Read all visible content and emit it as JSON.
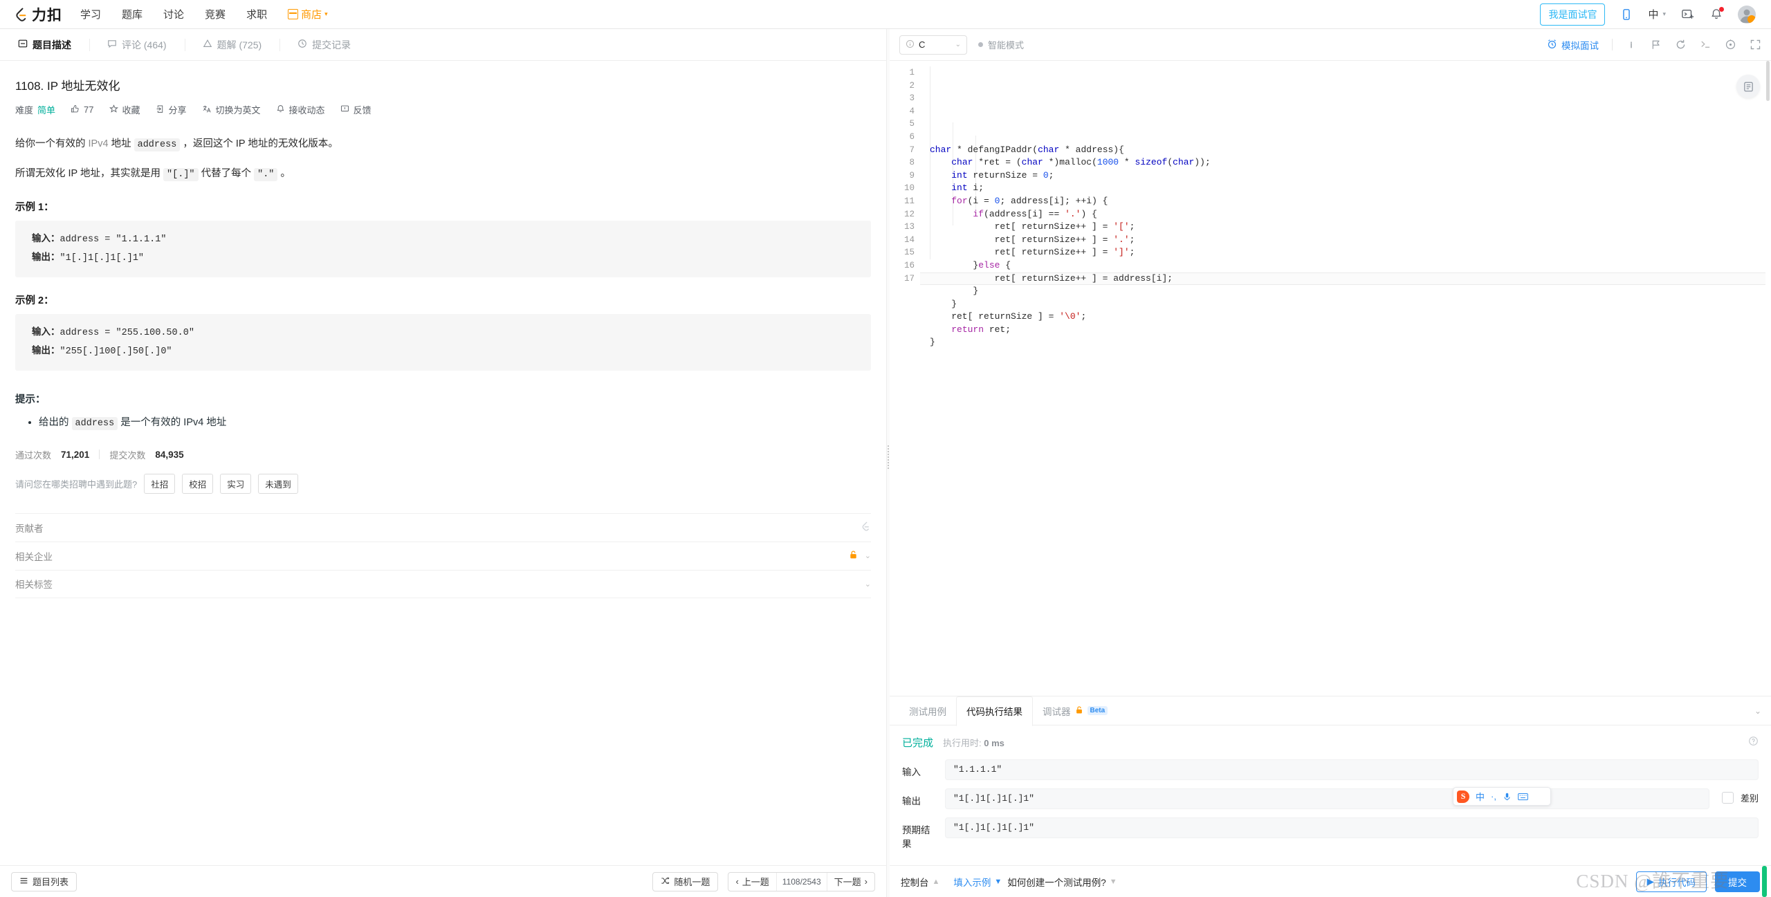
{
  "nav": {
    "brand": "力扣",
    "links": [
      {
        "label": "学习",
        "name": "nav-study"
      },
      {
        "label": "题库",
        "name": "nav-problems"
      },
      {
        "label": "讨论",
        "name": "nav-discuss"
      },
      {
        "label": "竞赛",
        "name": "nav-contest"
      },
      {
        "label": "求职",
        "name": "nav-jobs"
      }
    ],
    "shop": "商店",
    "interviewer_button": "我是面试官",
    "lang": "中"
  },
  "left": {
    "tabs": [
      {
        "label": "题目描述",
        "icon": "description-icon",
        "active": true
      },
      {
        "label": "评论 (464)",
        "icon": "comment-icon",
        "active": false
      },
      {
        "label": "题解 (725)",
        "icon": "solution-icon",
        "active": false
      },
      {
        "label": "提交记录",
        "icon": "clock-icon",
        "active": false
      }
    ],
    "problem_title": "1108. IP 地址无效化",
    "meta": {
      "difficulty_label": "难度",
      "difficulty_value": "简单",
      "likes": "77",
      "favorite": "收藏",
      "share": "分享",
      "switch_lang": "切换为英文",
      "subscribe": "接收动态",
      "feedback": "反馈"
    },
    "desc": {
      "p1_a": "给你一个有效的 ",
      "p1_ipv4": "IPv4",
      "p1_b": " 地址 ",
      "p1_code": "address",
      "p1_c": " ，返回这个 IP 地址的无效化版本。",
      "p2_a": "所谓无效化 IP 地址，其实就是用 ",
      "p2_code1": "\"[.]\"",
      "p2_b": " 代替了每个 ",
      "p2_code2": "\".\"",
      "p2_c": " 。"
    },
    "examples": [
      {
        "heading": "示例 1：",
        "input_label": "输入：",
        "input_value": "address = \"1.1.1.1\"",
        "output_label": "输出：",
        "output_value": "\"1[.]1[.]1[.]1\""
      },
      {
        "heading": "示例 2：",
        "input_label": "输入：",
        "input_value": "address = \"255.100.50.0\"",
        "output_label": "输出：",
        "output_value": "\"255[.]100[.]50[.]0\""
      }
    ],
    "hints": {
      "heading": "提示：",
      "item_a": "给出的 ",
      "item_code": "address",
      "item_b": " 是一个有效的 IPv4 地址"
    },
    "stats": {
      "accepted_label": "通过次数",
      "accepted_value": "71,201",
      "submitted_label": "提交次数",
      "submitted_value": "84,935"
    },
    "poll": {
      "question": "请问您在哪类招聘中遇到此题?",
      "options": [
        "社招",
        "校招",
        "实习",
        "未遇到"
      ]
    },
    "collapsibles": [
      {
        "label": "贡献者",
        "name": "section-contributors",
        "lock": false
      },
      {
        "label": "相关企业",
        "name": "section-companies",
        "lock": true
      },
      {
        "label": "相关标签",
        "name": "section-tags",
        "lock": false
      }
    ],
    "bottom": {
      "problem_list": "题目列表",
      "random": "随机一题",
      "prev": "上一题",
      "counter": "1108/2543",
      "next": "下一题"
    }
  },
  "editor": {
    "language": "C",
    "smart_mode": "智能模式",
    "mock_interview": "模拟面试",
    "icons": [
      "info-icon",
      "flag-icon",
      "reset-icon",
      "terminal-icon",
      "settings-icon",
      "fullscreen-icon"
    ],
    "code_lines": [
      {
        "n": 1,
        "tokens": [
          [
            "k",
            "char"
          ],
          [
            "fn",
            " * "
          ],
          [
            "fn",
            "defangIPaddr"
          ],
          [
            "fn",
            "("
          ],
          [
            "k",
            "char"
          ],
          [
            "fn",
            " * address){"
          ]
        ]
      },
      {
        "n": 2,
        "tokens": [
          [
            "fn",
            "    "
          ],
          [
            "k",
            "char"
          ],
          [
            "fn",
            " *ret = ("
          ],
          [
            "k",
            "char"
          ],
          [
            "fn",
            " *)"
          ],
          [
            "fn",
            "malloc"
          ],
          [
            "fn",
            "("
          ],
          [
            "n",
            "1000"
          ],
          [
            "fn",
            " * "
          ],
          [
            "k",
            "sizeof"
          ],
          [
            "fn",
            "("
          ],
          [
            "k",
            "char"
          ],
          [
            "fn",
            "));"
          ]
        ]
      },
      {
        "n": 3,
        "tokens": [
          [
            "fn",
            "    "
          ],
          [
            "k",
            "int"
          ],
          [
            "fn",
            " returnSize = "
          ],
          [
            "n",
            "0"
          ],
          [
            "fn",
            ";"
          ]
        ]
      },
      {
        "n": 4,
        "tokens": [
          [
            "fn",
            "    "
          ],
          [
            "k",
            "int"
          ],
          [
            "fn",
            " i;"
          ]
        ]
      },
      {
        "n": 5,
        "tokens": [
          [
            "fn",
            "    "
          ],
          [
            "kw",
            "for"
          ],
          [
            "fn",
            "(i = "
          ],
          [
            "n",
            "0"
          ],
          [
            "fn",
            "; address[i]; ++i) {"
          ]
        ]
      },
      {
        "n": 6,
        "tokens": [
          [
            "fn",
            "        "
          ],
          [
            "kw",
            "if"
          ],
          [
            "fn",
            "(address[i] == "
          ],
          [
            "s",
            "'.'"
          ],
          [
            "fn",
            ") {"
          ]
        ]
      },
      {
        "n": 7,
        "tokens": [
          [
            "fn",
            "            ret[ returnSize++ ] = "
          ],
          [
            "s",
            "'['"
          ],
          [
            "fn",
            ";"
          ]
        ]
      },
      {
        "n": 8,
        "tokens": [
          [
            "fn",
            "            ret[ returnSize++ ] = "
          ],
          [
            "s",
            "'.'"
          ],
          [
            "fn",
            ";"
          ]
        ]
      },
      {
        "n": 9,
        "tokens": [
          [
            "fn",
            "            ret[ returnSize++ ] = "
          ],
          [
            "s",
            "']'"
          ],
          [
            "fn",
            ";"
          ]
        ]
      },
      {
        "n": 10,
        "tokens": [
          [
            "fn",
            "        }"
          ],
          [
            "kw",
            "else"
          ],
          [
            "fn",
            " {"
          ]
        ]
      },
      {
        "n": 11,
        "tokens": [
          [
            "fn",
            "            ret[ returnSize++ ] = address[i];"
          ]
        ]
      },
      {
        "n": 12,
        "tokens": [
          [
            "fn",
            "        }"
          ]
        ]
      },
      {
        "n": 13,
        "tokens": [
          [
            "fn",
            "    }"
          ]
        ]
      },
      {
        "n": 14,
        "tokens": [
          [
            "fn",
            "    ret[ returnSize ] = "
          ],
          [
            "s",
            "'\\0'"
          ],
          [
            "fn",
            ";"
          ]
        ]
      },
      {
        "n": 15,
        "tokens": [
          [
            "fn",
            "    "
          ],
          [
            "kw",
            "return"
          ],
          [
            "fn",
            " ret;"
          ]
        ]
      },
      {
        "n": 16,
        "tokens": [
          [
            "fn",
            "}"
          ]
        ]
      },
      {
        "n": 17,
        "tokens": [
          [
            "fn",
            ""
          ]
        ]
      }
    ]
  },
  "console": {
    "tabs": [
      {
        "label": "测试用例",
        "active": false,
        "lock": false,
        "beta": ""
      },
      {
        "label": "代码执行结果",
        "active": true,
        "lock": false,
        "beta": ""
      },
      {
        "label": "调试器",
        "active": false,
        "lock": true,
        "beta": "Beta"
      }
    ],
    "status": "已完成",
    "runtime_label": "执行用时:",
    "runtime_value": "0 ms",
    "rows": [
      {
        "label": "输入",
        "value": "\"1.1.1.1\"",
        "name": "testcase-input"
      },
      {
        "label": "输出",
        "value": "\"1[.]1[.]1[.]1\"",
        "name": "testcase-output"
      },
      {
        "label": "预期结果",
        "value": "\"1[.]1[.]1[.]1\"",
        "name": "testcase-expected"
      }
    ],
    "diff_label": "差别",
    "bottom": {
      "console_toggle": "控制台",
      "fill_example": "填入示例",
      "how_to": "如何创建一个测试用例?",
      "run": "执行代码",
      "submit": "提交"
    }
  },
  "ime": {
    "logo": "S",
    "mode": "中",
    "punct": "·,",
    "mic": "mic-icon",
    "keyboard": "keyboard-icon",
    "apps": "apps-icon"
  },
  "watermark": "CSDN @誰不重要",
  "colors": {
    "accent": "#2d8cf0",
    "easy": "#00af9b",
    "orange": "#f90"
  }
}
